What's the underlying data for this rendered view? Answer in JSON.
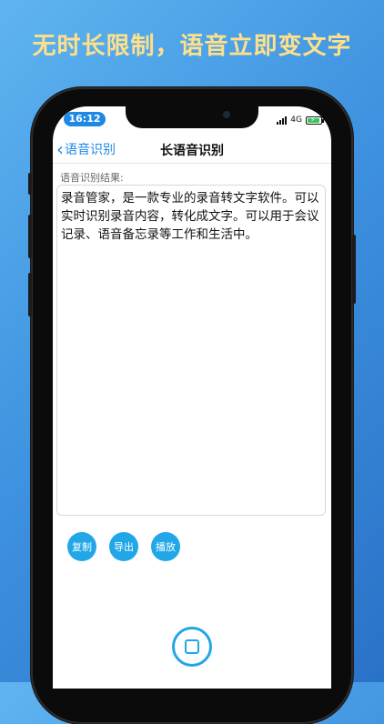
{
  "headline": "无时长限制，语音立即变文字",
  "status": {
    "time": "16:12",
    "network": "4G"
  },
  "nav": {
    "back_label": "语音识别",
    "title": "长语音识别"
  },
  "result": {
    "label": "语音识别结果:",
    "text": "录音管家，是一款专业的录音转文字软件。可以实时识别录音内容，转化成文字。可以用于会议记录、语音备忘录等工作和生活中。"
  },
  "actions": {
    "copy": "复制",
    "export": "导出",
    "play": "播放"
  },
  "colors": {
    "accent": "#21a7e8",
    "link": "#1e88e5",
    "headline": "#ffe08a"
  },
  "icons": {
    "back": "chevron-left-icon",
    "stop": "stop-icon",
    "signal": "signal-icon",
    "battery": "battery-charging-icon"
  }
}
